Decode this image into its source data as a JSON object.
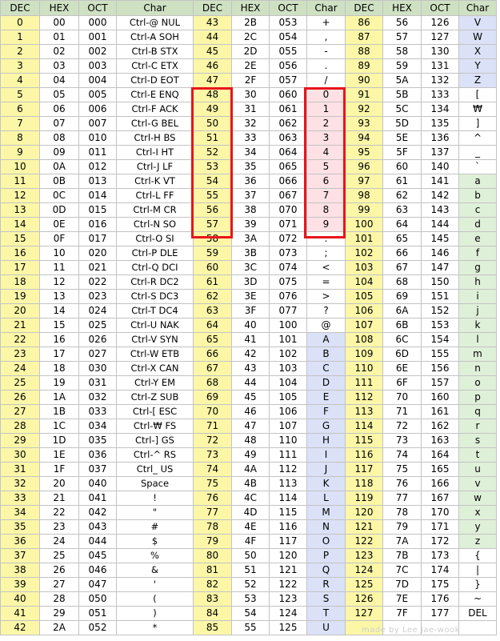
{
  "headers": [
    "DEC",
    "HEX",
    "OCT",
    "Char",
    "DEC",
    "HEX",
    "OCT",
    "Char",
    "DEC",
    "HEX",
    "OCT",
    "Char"
  ],
  "rows": [
    [
      "0",
      "00",
      "000",
      "Ctrl-@ NUL",
      "43",
      "2B",
      "053",
      "+",
      "86",
      "56",
      "126",
      "V"
    ],
    [
      "1",
      "01",
      "001",
      "Ctrl-A SOH",
      "44",
      "2C",
      "054",
      ",",
      "87",
      "57",
      "127",
      "W"
    ],
    [
      "2",
      "02",
      "002",
      "Ctrl-B STX",
      "45",
      "2D",
      "055",
      "-",
      "88",
      "58",
      "130",
      "X"
    ],
    [
      "3",
      "03",
      "003",
      "Ctrl-C ETX",
      "46",
      "2E",
      "056",
      ".",
      "89",
      "59",
      "131",
      "Y"
    ],
    [
      "4",
      "04",
      "004",
      "Ctrl-D EOT",
      "47",
      "2F",
      "057",
      "/",
      "90",
      "5A",
      "132",
      "Z"
    ],
    [
      "5",
      "05",
      "005",
      "Ctrl-E ENQ",
      "48",
      "30",
      "060",
      "0",
      "91",
      "5B",
      "133",
      "["
    ],
    [
      "6",
      "06",
      "006",
      "Ctrl-F ACK",
      "49",
      "31",
      "061",
      "1",
      "92",
      "5C",
      "134",
      "₩"
    ],
    [
      "7",
      "07",
      "007",
      "Ctrl-G BEL",
      "50",
      "32",
      "062",
      "2",
      "93",
      "5D",
      "135",
      "]"
    ],
    [
      "8",
      "08",
      "010",
      "Ctrl-H BS",
      "51",
      "33",
      "063",
      "3",
      "94",
      "5E",
      "136",
      "^"
    ],
    [
      "9",
      "09",
      "011",
      "Ctrl-I HT",
      "52",
      "34",
      "064",
      "4",
      "95",
      "5F",
      "137",
      "_"
    ],
    [
      "10",
      "0A",
      "012",
      "Ctrl-J LF",
      "53",
      "35",
      "065",
      "5",
      "96",
      "60",
      "140",
      "`"
    ],
    [
      "11",
      "0B",
      "013",
      "Ctrl-K VT",
      "54",
      "36",
      "066",
      "6",
      "97",
      "61",
      "141",
      "a"
    ],
    [
      "12",
      "0C",
      "014",
      "Ctrl-L FF",
      "55",
      "37",
      "067",
      "7",
      "98",
      "62",
      "142",
      "b"
    ],
    [
      "13",
      "0D",
      "015",
      "Ctrl-M CR",
      "56",
      "38",
      "070",
      "8",
      "99",
      "63",
      "143",
      "c"
    ],
    [
      "14",
      "0E",
      "016",
      "Ctrl-N SO",
      "57",
      "39",
      "071",
      "9",
      "100",
      "64",
      "144",
      "d"
    ],
    [
      "15",
      "0F",
      "017",
      "Ctrl-O SI",
      "58",
      "3A",
      "072",
      ":",
      "101",
      "65",
      "145",
      "e"
    ],
    [
      "16",
      "10",
      "020",
      "Ctrl-P DLE",
      "59",
      "3B",
      "073",
      ";",
      "102",
      "66",
      "146",
      "f"
    ],
    [
      "17",
      "11",
      "021",
      "Ctrl-Q DCI",
      "60",
      "3C",
      "074",
      "<",
      "103",
      "67",
      "147",
      "g"
    ],
    [
      "18",
      "12",
      "022",
      "Ctrl-R DC2",
      "61",
      "3D",
      "075",
      "=",
      "104",
      "68",
      "150",
      "h"
    ],
    [
      "19",
      "13",
      "023",
      "Ctrl-S DC3",
      "62",
      "3E",
      "076",
      ">",
      "105",
      "69",
      "151",
      "i"
    ],
    [
      "20",
      "14",
      "024",
      "Ctrl-T DC4",
      "63",
      "3F",
      "077",
      "?",
      "106",
      "6A",
      "152",
      "j"
    ],
    [
      "21",
      "15",
      "025",
      "Ctrl-U NAK",
      "64",
      "40",
      "100",
      "@",
      "107",
      "6B",
      "153",
      "k"
    ],
    [
      "22",
      "16",
      "026",
      "Ctrl-V SYN",
      "65",
      "41",
      "101",
      "A",
      "108",
      "6C",
      "154",
      "l"
    ],
    [
      "23",
      "17",
      "027",
      "Ctrl-W ETB",
      "66",
      "42",
      "102",
      "B",
      "109",
      "6D",
      "155",
      "m"
    ],
    [
      "24",
      "18",
      "030",
      "Ctrl-X CAN",
      "67",
      "43",
      "103",
      "C",
      "110",
      "6E",
      "156",
      "n"
    ],
    [
      "25",
      "19",
      "031",
      "Ctrl-Y EM",
      "68",
      "44",
      "104",
      "D",
      "111",
      "6F",
      "157",
      "o"
    ],
    [
      "26",
      "1A",
      "032",
      "Ctrl-Z SUB",
      "69",
      "45",
      "105",
      "E",
      "112",
      "70",
      "160",
      "p"
    ],
    [
      "27",
      "1B",
      "033",
      "Ctrl-[ ESC",
      "70",
      "46",
      "106",
      "F",
      "113",
      "71",
      "161",
      "q"
    ],
    [
      "28",
      "1C",
      "034",
      "Ctrl-₩ FS",
      "71",
      "47",
      "107",
      "G",
      "114",
      "72",
      "162",
      "r"
    ],
    [
      "29",
      "1D",
      "035",
      "Ctrl-] GS",
      "72",
      "48",
      "110",
      "H",
      "115",
      "73",
      "163",
      "s"
    ],
    [
      "30",
      "1E",
      "036",
      "Ctrl-^ RS",
      "73",
      "49",
      "111",
      "I",
      "116",
      "74",
      "164",
      "t"
    ],
    [
      "31",
      "1F",
      "037",
      "Ctrl_ US",
      "74",
      "4A",
      "112",
      "J",
      "117",
      "75",
      "165",
      "u"
    ],
    [
      "32",
      "20",
      "040",
      "Space",
      "75",
      "4B",
      "113",
      "K",
      "118",
      "76",
      "166",
      "v"
    ],
    [
      "33",
      "21",
      "041",
      "!",
      "76",
      "4C",
      "114",
      "L",
      "119",
      "77",
      "167",
      "w"
    ],
    [
      "34",
      "22",
      "042",
      "\"",
      "77",
      "4D",
      "115",
      "M",
      "120",
      "78",
      "170",
      "x"
    ],
    [
      "35",
      "23",
      "043",
      "#",
      "78",
      "4E",
      "116",
      "N",
      "121",
      "79",
      "171",
      "y"
    ],
    [
      "36",
      "24",
      "044",
      "$",
      "79",
      "4F",
      "117",
      "O",
      "122",
      "7A",
      "172",
      "z"
    ],
    [
      "37",
      "25",
      "045",
      "%",
      "80",
      "50",
      "120",
      "P",
      "123",
      "7B",
      "173",
      "{"
    ],
    [
      "38",
      "26",
      "046",
      "&",
      "81",
      "51",
      "121",
      "Q",
      "124",
      "7C",
      "174",
      "|"
    ],
    [
      "39",
      "27",
      "047",
      "'",
      "82",
      "52",
      "122",
      "R",
      "125",
      "7D",
      "175",
      "}"
    ],
    [
      "40",
      "28",
      "050",
      "(",
      "83",
      "53",
      "123",
      "S",
      "126",
      "7E",
      "176",
      "~"
    ],
    [
      "41",
      "29",
      "051",
      ")",
      "84",
      "54",
      "124",
      "T",
      "127",
      "7F",
      "177",
      "DEL"
    ],
    [
      "42",
      "2A",
      "052",
      "*",
      "85",
      "55",
      "125",
      "U",
      "",
      "",
      "",
      ""
    ]
  ],
  "watermark": "made by Lee Jae-wook",
  "colors": {
    "header": "#cfe1c2",
    "dec_cell": "#fbf7a7",
    "uppercase_cell": "#dbe1f7",
    "lowercase_cell": "#dff0d8",
    "digit_cell": "#fde1e5",
    "highlight_box": "#e8141b"
  }
}
